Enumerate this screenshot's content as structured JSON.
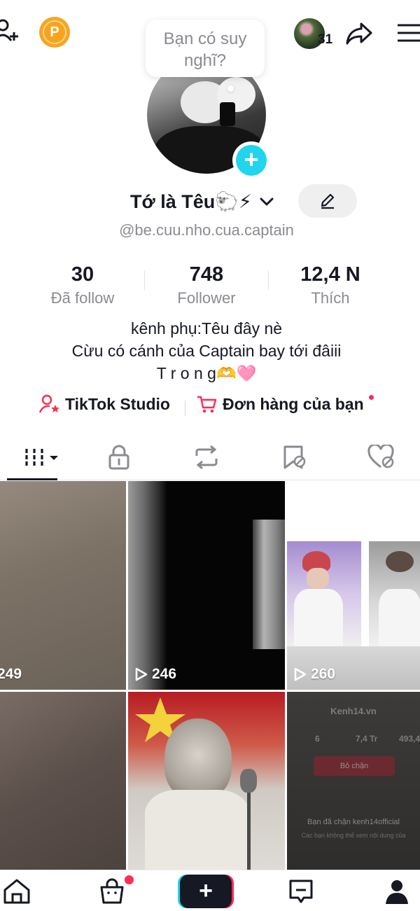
{
  "bubble": {
    "text": "Bạn có suy nghĩ?"
  },
  "header": {
    "coin_label": "P",
    "friends_count": "31"
  },
  "profile": {
    "name": "Tớ là Têu🐑⚡",
    "handle": "@be.cuu.nho.cua.captain",
    "bio_lines": [
      "kênh phụ:Têu đây nè",
      "Cừu có cánh của Captain bay tới đâiii",
      "T r o n g🫶🩷"
    ]
  },
  "stats": [
    {
      "value": "30",
      "label": "Đã follow"
    },
    {
      "value": "748",
      "label": "Follower"
    },
    {
      "value": "12,4 N",
      "label": "Thích"
    }
  ],
  "links": {
    "studio": "TikTok Studio",
    "orders": "Đơn hàng của bạn"
  },
  "tabs": [
    {
      "name": "videos",
      "icon": "grid-icon"
    },
    {
      "name": "private",
      "icon": "lock-icon"
    },
    {
      "name": "reposts",
      "icon": "repost-icon"
    },
    {
      "name": "favorites",
      "icon": "bookmark-icon"
    },
    {
      "name": "liked",
      "icon": "heart-icon"
    }
  ],
  "videos": [
    {
      "views": "249"
    },
    {
      "views": "246"
    },
    {
      "views": "260"
    },
    {
      "views": ""
    },
    {
      "views": ""
    },
    {
      "views": ""
    }
  ],
  "tile6": {
    "title": "Kenh14.vn",
    "stats": [
      "6",
      "7,4 Tr",
      "493,4"
    ],
    "button": "Bỏ chặn",
    "blocked": "Bạn đã chặn kenh14official",
    "sub": "Các bạn không thể xem nội dung của"
  },
  "colors": {
    "accent_red": "#fe2c55",
    "accent_cyan": "#20d5ec",
    "text_secondary": "#8a8b91"
  }
}
